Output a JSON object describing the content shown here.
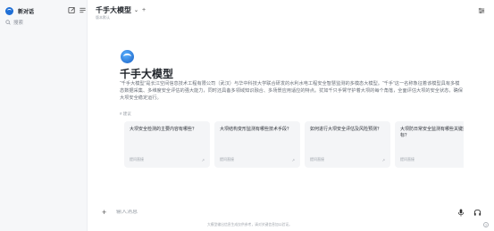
{
  "sidebar": {
    "title": "新对话",
    "search_label": "搜索"
  },
  "header": {
    "title": "千手大模型",
    "chevron": "⌄",
    "plus": "+",
    "subtitle": "版本默认"
  },
  "hero": {
    "title": "千手大模型",
    "description": "“千手大模型”是长江空间信息技术工程有限公司（武汉）与华中科技大学联合研发的水利水电工程安全智慧监测的多模态大模型。“千手”这一名称象征着该模型具有多模态数据采集、多维度安全评估的强大能力，同时还具备多领域知识融合、多场景应用适应的特点。犹如千只手臂守护着大坝的每个角落，全面评估大坝的安全状态，确保大坝安全稳定运行。",
    "suggest_label": "# 建议"
  },
  "cards": [
    {
      "question": "大坝安全检测的主要内容有哪些？",
      "foot": "提问直接"
    },
    {
      "question": "大坝结构变形监测有哪些技术手段？",
      "foot": "提问直接"
    },
    {
      "question": "如何进行大坝安全评估及风险预测？",
      "foot": "提问直接"
    },
    {
      "question": "大坝防日常安全监测有哪些关键指标？",
      "foot": "提问直接"
    }
  ],
  "input": {
    "placeholder": "输入消息"
  },
  "footnote": "大模型输出信息生成仅供参考，请对关键信息加以验证。",
  "colors": {
    "accent": "#1f6fd6",
    "sidebar_bg": "#f6f7f9",
    "card_bg": "#f4f5f7"
  }
}
